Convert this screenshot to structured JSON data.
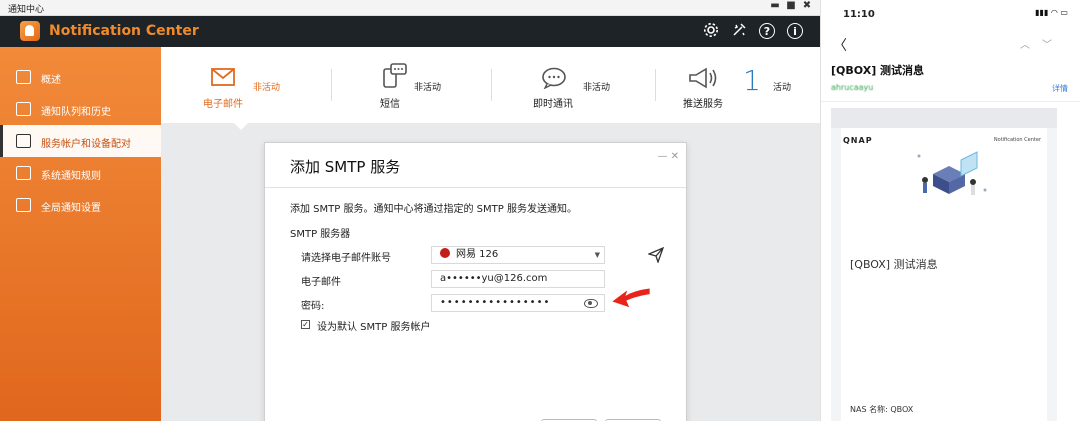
{
  "window": {
    "title": "通知中心",
    "minimize": "▬",
    "maximize": "■",
    "close": "✖"
  },
  "app": {
    "title": "Notification Center",
    "toolbar_icons": [
      "gear-icon",
      "tools-icon",
      "help-icon",
      "info-icon"
    ],
    "help_glyph": "?",
    "info_glyph": "i"
  },
  "sidebar": {
    "items": [
      {
        "label": "概述",
        "icon": "overview-icon"
      },
      {
        "label": "通知队列和历史",
        "icon": "history-icon"
      },
      {
        "label": "服务帐户和设备配对",
        "icon": "device-icon",
        "active": true
      },
      {
        "label": "系统通知规则",
        "icon": "rules-icon"
      },
      {
        "label": "全局通知设置",
        "icon": "settings-icon"
      }
    ]
  },
  "tabs": [
    {
      "name": "电子邮件",
      "status": "非活动",
      "icon": "email-icon",
      "active": true
    },
    {
      "name": "短信",
      "status": "非活动",
      "icon": "sms-icon"
    },
    {
      "name": "即时通讯",
      "status": "非活动",
      "icon": "chat-icon"
    },
    {
      "name": "推送服务",
      "status": "活动",
      "icon": "push-icon",
      "count": "1"
    }
  ],
  "dialog": {
    "title": "添加 SMTP 服务",
    "description": "添加 SMTP 服务。通知中心将通过指定的 SMTP 服务发送通知。",
    "section": "SMTP 服务器",
    "account_label": "请选择电子邮件账号",
    "account_value": "网易 126",
    "email_label": "电子邮件",
    "email_value": "a••••••yu@126.com",
    "password_label": "密码:",
    "password_value": "••••••••••••••••",
    "default_checkbox_label": "设为默认 SMTP 服务帐户",
    "default_checked": true,
    "close_glyphs": "—  ✕"
  },
  "phone": {
    "time": "11:10",
    "status": "▮▮▮ ◠ ▭",
    "back": "〈",
    "updown": "︿﹀",
    "subject": "[QBOX] 测试消息",
    "sender": "ahrucaayu",
    "detail": "详情",
    "brand": "QNAP",
    "nc_label": "Notification Center",
    "message": "[QBOX] 测试消息",
    "nas_name": "NAS 名称: QBOX"
  },
  "colors": {
    "accent": "#e36a1d",
    "topbar": "#1e2327",
    "arrow": "#e8231a"
  }
}
